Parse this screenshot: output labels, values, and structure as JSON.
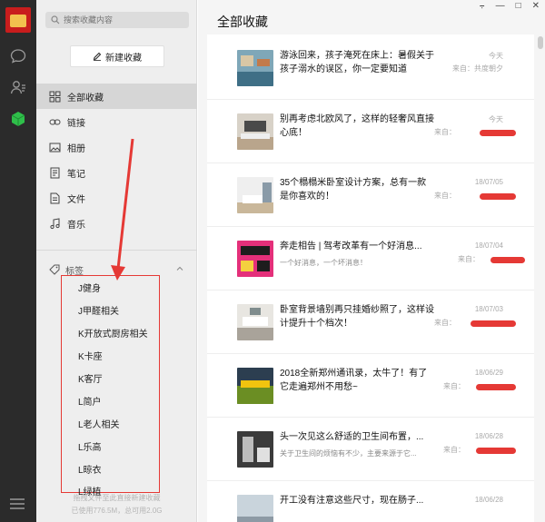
{
  "rail": {
    "icons": [
      "avatar",
      "chat-icon",
      "contacts-icon",
      "favorites-icon",
      "menu-icon"
    ]
  },
  "nav": {
    "search_placeholder": "搜索收藏内容",
    "new_button": "新建收藏",
    "items": [
      {
        "label": "全部收藏",
        "icon": "grid-icon"
      },
      {
        "label": "链接",
        "icon": "link-icon"
      },
      {
        "label": "相册",
        "icon": "album-icon"
      },
      {
        "label": "笔记",
        "icon": "note-icon"
      },
      {
        "label": "文件",
        "icon": "file-icon"
      },
      {
        "label": "音乐",
        "icon": "music-icon"
      }
    ],
    "tags_label": "标签",
    "tags": [
      "J健身",
      "J甲醛相关",
      "K开放式厨房相关",
      "K卡座",
      "K客厅",
      "L简户",
      "L老人相关",
      "L乐高",
      "L晾衣",
      "L绿植"
    ],
    "footer_hint": "拖拽文件至此直接新建收藏",
    "footer_storage": "已使用776.5M，总可用2.0G"
  },
  "content": {
    "title": "全部收藏",
    "cards": [
      {
        "title": "游泳回来，孩子淹死在床上：暑假关于孩子溺水的误区，你一定要知道",
        "sub": "",
        "date": "今天",
        "source": "来自：共度朝夕"
      },
      {
        "title": "别再考虑北欧风了，这样的轻奢风直接心底！",
        "sub": "",
        "date": "今天",
        "source": "来自："
      },
      {
        "title": "35个榻榻米卧室设计方案，总有一款是你喜欢的！",
        "sub": "",
        "date": "18/07/05",
        "source": "来自："
      },
      {
        "title": "奔走相告 | 驾考改革有一个好消息...",
        "sub": "一个好消息，一个坏消息！",
        "date": "18/07/04",
        "source": "来自："
      },
      {
        "title": "卧室背景墙别再只挂婚纱照了，这样设计提升十个档次！",
        "sub": "",
        "date": "18/07/03",
        "source": "来自："
      },
      {
        "title": "2018全新郑州通讯录，太牛了！有了它走遍郑州不用愁~",
        "sub": "",
        "date": "18/06/29",
        "source": "来自："
      },
      {
        "title": "头一次见这么舒适的卫生间布置，...",
        "sub": "关于卫生间的烦恼有不少，主要来源于它...",
        "date": "18/06/28",
        "source": "来自："
      },
      {
        "title": "开工没有注意这些尺寸，现在肠子...",
        "sub": "",
        "date": "18/06/28",
        "source": ""
      }
    ]
  }
}
